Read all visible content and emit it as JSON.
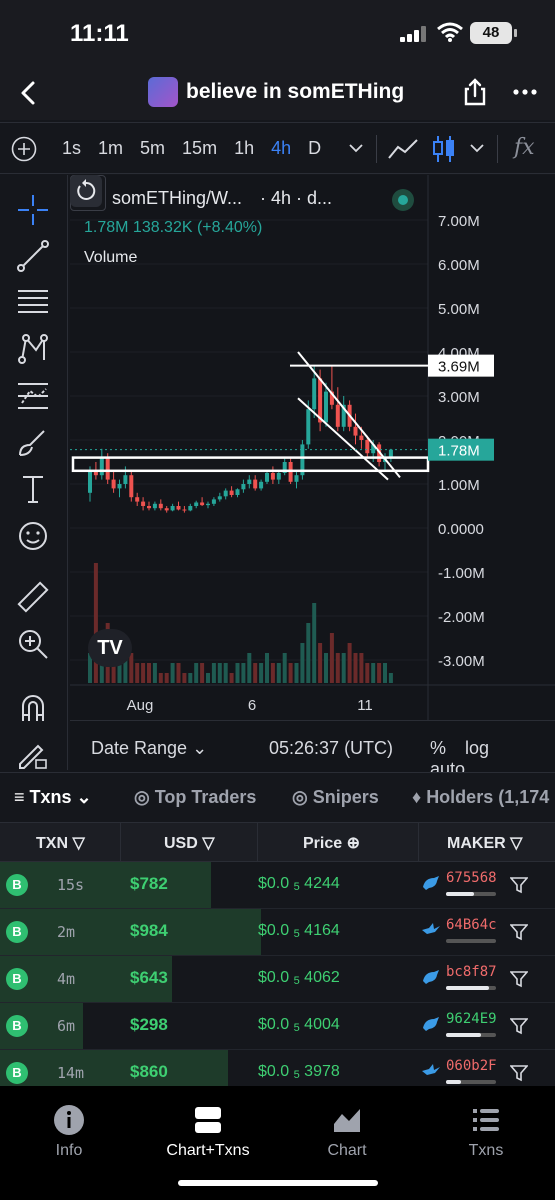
{
  "status_bar": {
    "time": "11:11",
    "battery": "48"
  },
  "header": {
    "title": "believe in somETHing"
  },
  "toolbar": {
    "intervals": [
      "1s",
      "1m",
      "5m",
      "15m",
      "1h",
      "4h",
      "D"
    ],
    "active_interval": "4h",
    "fx_label": "fx"
  },
  "legend": {
    "symbol": "somETHing/W...",
    "interval_note": "· 4h · d...",
    "value_line": "1.78M  138.32K (+8.40%)",
    "volume_label": "Volume"
  },
  "chart_data": {
    "type": "candlestick",
    "y_ticks": [
      "7.00M",
      "6.00M",
      "5.00M",
      "4.00M",
      "3.00M",
      "2.00M",
      "1.00M",
      "0.0000",
      "-1.00M",
      "-2.00M",
      "-3.00M"
    ],
    "x_ticks": [
      "Aug",
      "6",
      "11"
    ],
    "price_labels": [
      {
        "label": "3.69M",
        "value": 3690000,
        "color": "#ffffff"
      },
      {
        "label": "1.78M",
        "value": 1780000,
        "color": "#26a69a"
      }
    ],
    "ylim": [
      -3500000,
      7500000
    ],
    "series": [
      {
        "values": [
          [
            0.8,
            1.4,
            0.6,
            1.3
          ],
          [
            1.3,
            1.5,
            1.1,
            1.2
          ],
          [
            1.2,
            1.8,
            1.1,
            1.6
          ],
          [
            1.6,
            1.7,
            1.0,
            1.1
          ],
          [
            1.1,
            1.3,
            0.8,
            0.9
          ],
          [
            0.9,
            1.1,
            0.7,
            1.0
          ],
          [
            1.0,
            1.4,
            0.9,
            1.2
          ],
          [
            1.2,
            1.3,
            0.6,
            0.7
          ],
          [
            0.7,
            0.8,
            0.5,
            0.6
          ],
          [
            0.6,
            0.7,
            0.4,
            0.5
          ],
          [
            0.5,
            0.6,
            0.4,
            0.45
          ],
          [
            0.45,
            0.6,
            0.4,
            0.55
          ],
          [
            0.55,
            0.65,
            0.4,
            0.45
          ],
          [
            0.45,
            0.5,
            0.35,
            0.4
          ],
          [
            0.4,
            0.55,
            0.38,
            0.5
          ],
          [
            0.5,
            0.6,
            0.4,
            0.42
          ],
          [
            0.42,
            0.5,
            0.35,
            0.4
          ],
          [
            0.4,
            0.55,
            0.38,
            0.5
          ],
          [
            0.5,
            0.62,
            0.45,
            0.58
          ],
          [
            0.58,
            0.7,
            0.5,
            0.52
          ],
          [
            0.52,
            0.6,
            0.45,
            0.55
          ],
          [
            0.55,
            0.7,
            0.5,
            0.65
          ],
          [
            0.65,
            0.8,
            0.6,
            0.72
          ],
          [
            0.72,
            0.9,
            0.65,
            0.85
          ],
          [
            0.85,
            0.95,
            0.7,
            0.75
          ],
          [
            0.75,
            0.9,
            0.7,
            0.88
          ],
          [
            0.88,
            1.1,
            0.8,
            1.0
          ],
          [
            1.0,
            1.2,
            0.9,
            1.1
          ],
          [
            1.1,
            1.2,
            0.85,
            0.9
          ],
          [
            0.9,
            1.1,
            0.85,
            1.05
          ],
          [
            1.05,
            1.3,
            1.0,
            1.25
          ],
          [
            1.25,
            1.4,
            1.0,
            1.1
          ],
          [
            1.1,
            1.3,
            1.0,
            1.25
          ],
          [
            1.25,
            1.6,
            1.2,
            1.5
          ],
          [
            1.5,
            1.6,
            1.0,
            1.05
          ],
          [
            1.05,
            1.3,
            0.9,
            1.2
          ],
          [
            1.2,
            2.0,
            1.1,
            1.9
          ],
          [
            1.9,
            2.9,
            1.8,
            2.7
          ],
          [
            2.7,
            3.7,
            2.5,
            3.4
          ],
          [
            3.4,
            3.6,
            2.2,
            2.4
          ],
          [
            2.4,
            3.3,
            2.3,
            3.1
          ],
          [
            3.1,
            3.7,
            2.7,
            2.8
          ],
          [
            2.8,
            3.2,
            2.2,
            2.3
          ],
          [
            2.3,
            3.0,
            2.2,
            2.8
          ],
          [
            2.8,
            2.9,
            2.2,
            2.3
          ],
          [
            2.3,
            2.6,
            1.9,
            2.1
          ],
          [
            2.1,
            2.3,
            1.8,
            2.0
          ],
          [
            2.0,
            2.1,
            1.6,
            1.7
          ],
          [
            1.7,
            2.0,
            1.5,
            1.9
          ],
          [
            1.9,
            1.95,
            1.4,
            1.5
          ],
          [
            1.5,
            1.7,
            1.3,
            1.6
          ],
          [
            1.6,
            1.8,
            1.5,
            1.78
          ]
        ]
      }
    ],
    "volume": [
      3,
      12,
      5,
      6,
      4,
      2,
      3,
      3,
      2,
      2,
      2,
      2,
      1,
      1,
      2,
      2,
      1,
      1,
      2,
      2,
      1,
      2,
      2,
      2,
      1,
      2,
      2,
      3,
      2,
      2,
      3,
      2,
      2,
      3,
      2,
      2,
      4,
      6,
      8,
      4,
      3,
      5,
      3,
      3,
      4,
      3,
      3,
      2,
      2,
      2,
      2,
      1
    ],
    "trendlines": [
      {
        "kind": "horizontal",
        "value": 3690000
      },
      {
        "kind": "zone",
        "top": 1600000,
        "bottom": 1300000
      },
      {
        "kind": "descending-channel"
      }
    ]
  },
  "date_row": {
    "date_range": "Date Range",
    "time_utc": "05:26:37 (UTC)",
    "pct": "%",
    "log": "log",
    "auto": "auto"
  },
  "tabs": [
    "Txns",
    "Top Traders",
    "Snipers",
    "Holders (1,174"
  ],
  "table": {
    "headers": [
      "TXN",
      "USD",
      "Price",
      "MAKER"
    ],
    "rows": [
      {
        "type": "B",
        "age": "15s",
        "usd": "$782",
        "price_prefix": "$0.0",
        "price_sub": "5",
        "price_rest": "4244",
        "maker": "675568",
        "maker_color": "#ef6b6b",
        "bar_frac": 0.38,
        "maker_frac": 0.55,
        "icon": "dolphin-icon"
      },
      {
        "type": "B",
        "age": "2m",
        "usd": "$984",
        "price_prefix": "$0.0",
        "price_sub": "5",
        "price_rest": "4164",
        "maker": "64B64c",
        "maker_color": "#ef6b6b",
        "bar_frac": 0.47,
        "maker_frac": 0.0,
        "icon": "bird-icon"
      },
      {
        "type": "B",
        "age": "4m",
        "usd": "$643",
        "price_prefix": "$0.0",
        "price_sub": "5",
        "price_rest": "4062",
        "maker": "bc8f87",
        "maker_color": "#ef6b6b",
        "bar_frac": 0.31,
        "maker_frac": 0.85,
        "icon": "dolphin-icon"
      },
      {
        "type": "B",
        "age": "6m",
        "usd": "$298",
        "price_prefix": "$0.0",
        "price_sub": "5",
        "price_rest": "4004",
        "maker": "9624E9",
        "maker_color": "#3ecf72",
        "bar_frac": 0.15,
        "maker_frac": 0.7,
        "icon": "dolphin-icon"
      },
      {
        "type": "B",
        "age": "14m",
        "usd": "$860",
        "price_prefix": "$0.0",
        "price_sub": "5",
        "price_rest": "3978",
        "maker": "060b2F",
        "maker_color": "#ef6b6b",
        "bar_frac": 0.41,
        "maker_frac": 0.3,
        "icon": "bird-icon"
      }
    ]
  },
  "bottom_nav": [
    "Info",
    "Chart+Txns",
    "Chart",
    "Txns"
  ],
  "colors": {
    "up": "#26a69a",
    "down": "#ef5350",
    "accent": "#3b82f6",
    "buy": "#2fbf71"
  }
}
